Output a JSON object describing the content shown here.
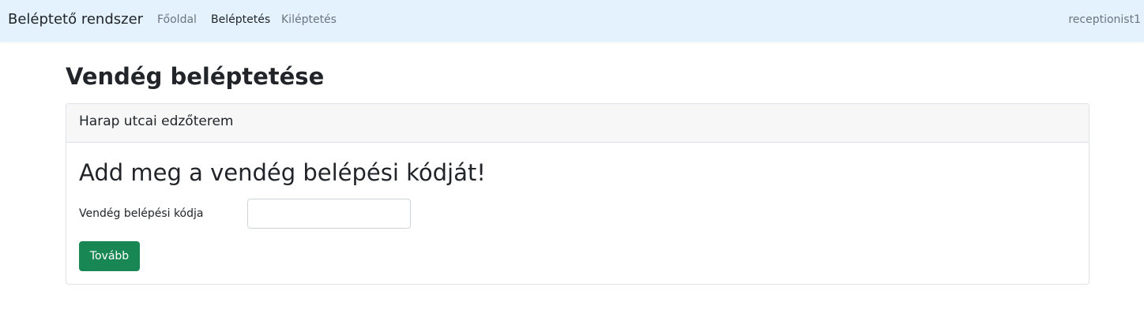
{
  "navbar": {
    "brand": "Beléptető rendszer",
    "links": [
      {
        "label": "Főoldal",
        "active": false
      },
      {
        "label": "Beléptetés",
        "active": true
      },
      {
        "label": "Kiléptetés",
        "active": false
      }
    ],
    "user": "receptionist1",
    "background_color": "#e3f2fd"
  },
  "page": {
    "title": "Vendég beléptetése"
  },
  "card": {
    "header": "Harap utcai edzőterem",
    "title": "Add meg a vendég belépési kódját!",
    "form": {
      "code_label": "Vendég belépési kódja",
      "code_value": "",
      "code_placeholder": "",
      "submit_label": "Tovább",
      "submit_color": "#198754"
    }
  }
}
